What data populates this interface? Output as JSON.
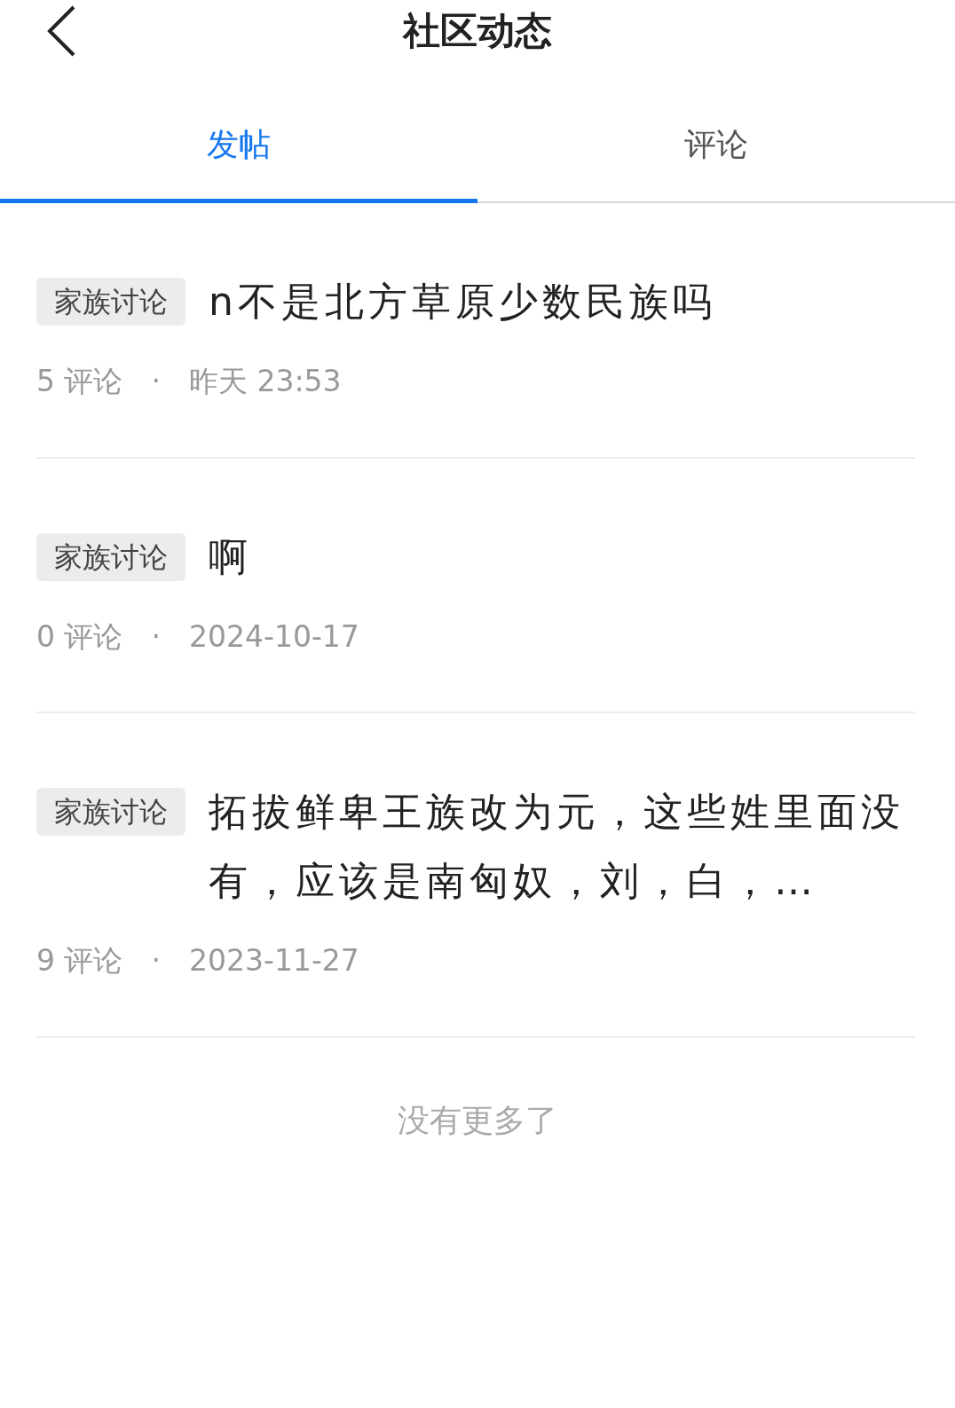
{
  "header": {
    "title": "社区动态"
  },
  "tabs": [
    {
      "label": "发帖",
      "selected": true
    },
    {
      "label": "评论",
      "selected": false
    }
  ],
  "posts": [
    {
      "tag": "家族讨论",
      "title": "n不是北方草原少数民族吗",
      "comments": "5 评论",
      "separator": "·",
      "time": "昨天 23:53"
    },
    {
      "tag": "家族讨论",
      "title": "啊",
      "comments": "0 评论",
      "separator": "·",
      "time": "2024-10-17"
    },
    {
      "tag": "家族讨论",
      "title": "拓拔鲜卑王族改为元，这些姓里面没有，应该是南匈奴，刘，白，…",
      "comments": "9 评论",
      "separator": "·",
      "time": "2023-11-27"
    }
  ],
  "footer": "没有更多了"
}
